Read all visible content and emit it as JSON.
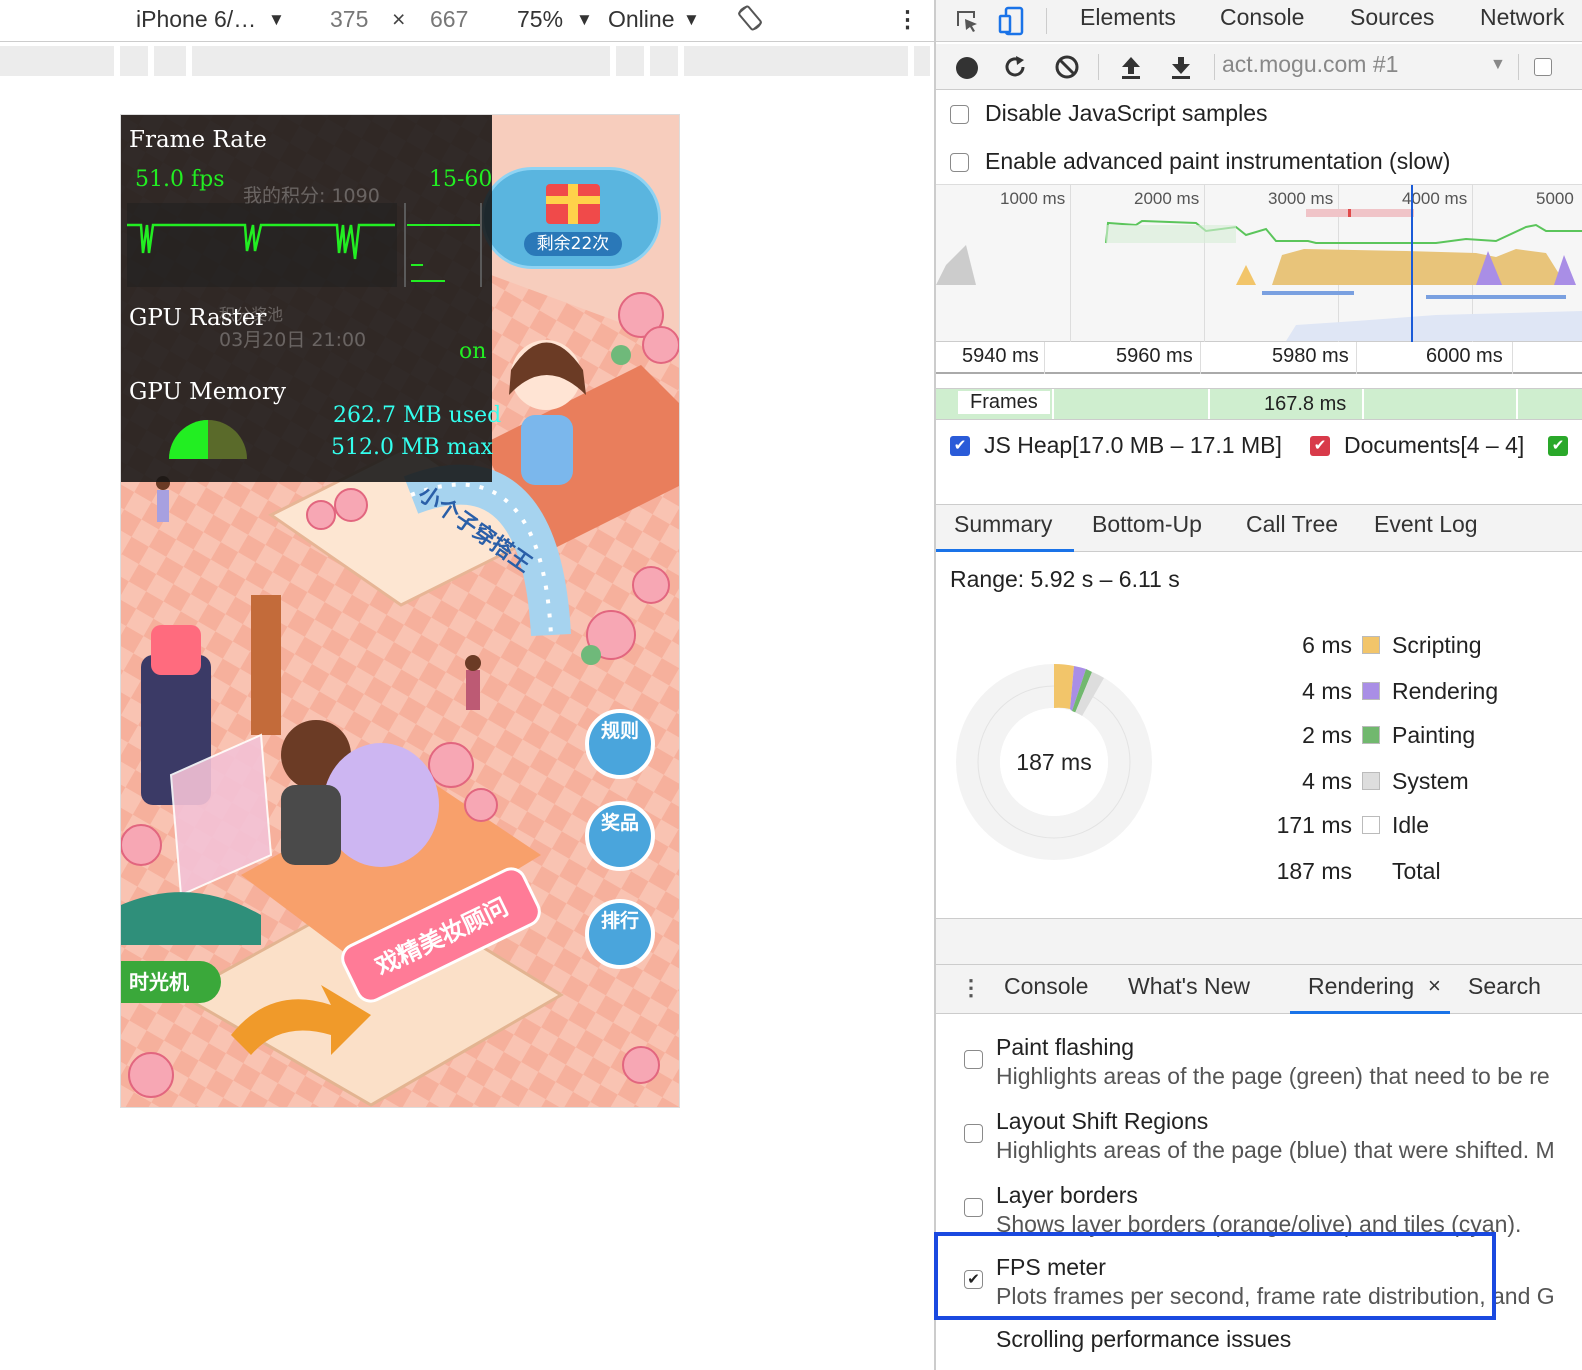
{
  "device_toolbar": {
    "device": "iPhone 6/…",
    "width": "375",
    "times": "×",
    "height": "667",
    "zoom": "75%",
    "network": "Online",
    "caret": "▼",
    "more": "⋮"
  },
  "fps_meter": {
    "frame_rate_title": "Frame Rate",
    "fps": "51.0 fps",
    "range": "15-60",
    "gpu_raster_title": "GPU Raster",
    "gpu_raster_value": "on",
    "gpu_memory_title": "GPU Memory",
    "memory_used": "262.7 MB used",
    "memory_max": "512.0 MB max"
  },
  "page": {
    "score_text": "我的积分: 1090",
    "gift_label": "剩余22次",
    "date_text": "03月20日 21:00",
    "pool_text": "积分奖池",
    "arch_text": "小个子穿搭王",
    "sign_text": "戏精美妆顾问",
    "rules_label": "规则",
    "prizes_label": "奖品",
    "rank_label": "排行",
    "time_machine_label": "时光机"
  },
  "devtools_tabs": [
    "Elements",
    "Console",
    "Sources",
    "Network"
  ],
  "perf_toolbar": {
    "target": "act.mogu.com #1"
  },
  "settings": {
    "disable_js_samples": "Disable JavaScript samples",
    "advanced_paint": "Enable advanced paint instrumentation (slow)"
  },
  "overview_ticks": [
    "1000 ms",
    "2000 ms",
    "3000 ms",
    "4000 ms",
    "5000"
  ],
  "detail_ticks": [
    "5940 ms",
    "5960 ms",
    "5980 ms",
    "6000 ms"
  ],
  "frames": {
    "label": "Frames",
    "duration": "167.8 ms"
  },
  "counters": {
    "js_heap": "JS Heap[17.0 MB – 17.1 MB]",
    "documents": "Documents[4 – 4]"
  },
  "bottom_tabs": [
    "Summary",
    "Bottom-Up",
    "Call Tree",
    "Event Log"
  ],
  "summary": {
    "range": "Range: 5.92 s – 6.11 s",
    "total_center": "187 ms",
    "rows": [
      {
        "value": "6 ms",
        "name": "Scripting",
        "color": "#f2c56a"
      },
      {
        "value": "4 ms",
        "name": "Rendering",
        "color": "#a98ee6"
      },
      {
        "value": "2 ms",
        "name": "Painting",
        "color": "#71b86e"
      },
      {
        "value": "4 ms",
        "name": "System",
        "color": "#dddddd"
      },
      {
        "value": "171 ms",
        "name": "Idle",
        "color": "#ffffff"
      },
      {
        "value": "187 ms",
        "name": "Total",
        "color": ""
      }
    ]
  },
  "drawer_tabs": {
    "console": "Console",
    "whats_new": "What's New",
    "rendering": "Rendering",
    "close": "×",
    "search": "Search"
  },
  "rendering_options": [
    {
      "title": "Paint flashing",
      "desc": "Highlights areas of the page (green) that need to be re",
      "checked": false
    },
    {
      "title": "Layout Shift Regions",
      "desc": "Highlights areas of the page (blue) that were shifted. M",
      "checked": false
    },
    {
      "title": "Layer borders",
      "desc": "Shows layer borders (orange/olive) and tiles (cyan).",
      "checked": false
    },
    {
      "title": "FPS meter",
      "desc": "Plots frames per second, frame rate distribution, and G",
      "checked": true
    },
    {
      "title": "Scrolling performance issues",
      "desc": "",
      "checked": false
    }
  ],
  "colors": {
    "highlight_box": "#1a49e0",
    "fps_green": "#22ee22",
    "fps_cyan": "#33ffee",
    "active_tab_underline": "#1a73e8"
  }
}
